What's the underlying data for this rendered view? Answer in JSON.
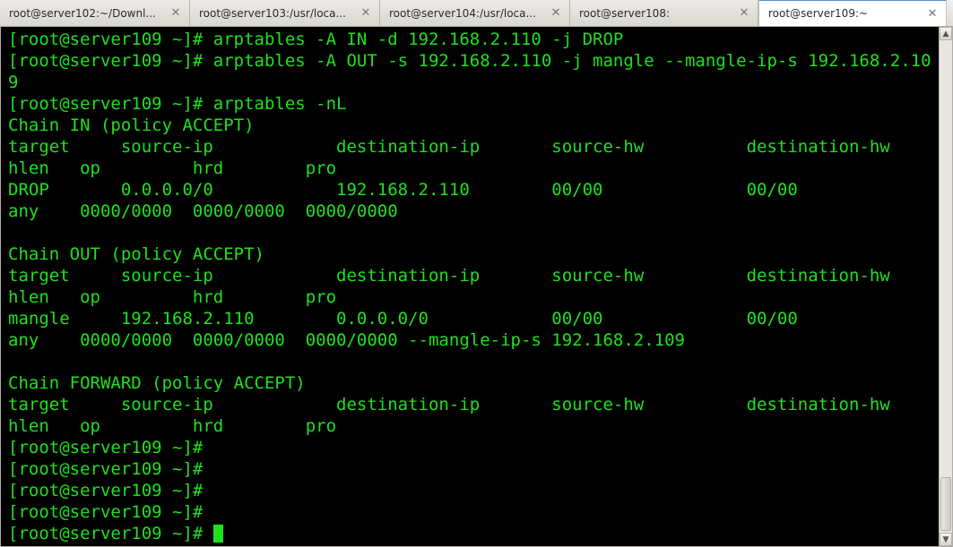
{
  "tabs": [
    {
      "label": "root@server102:~/Downl...",
      "active": false
    },
    {
      "label": "root@server103:/usr/loca...",
      "active": false
    },
    {
      "label": "root@server104:/usr/loca...",
      "active": false
    },
    {
      "label": "root@server108:",
      "active": false
    },
    {
      "label": "root@server109:~",
      "active": true
    }
  ],
  "prompt": "[root@server109 ~]# ",
  "terminal_lines": [
    "[root@server109 ~]# arptables -A IN -d 192.168.2.110 -j DROP",
    "[root@server109 ~]# arptables -A OUT -s 192.168.2.110 -j mangle --mangle-ip-s 192.168.2.109",
    "[root@server109 ~]# arptables -nL",
    "Chain IN (policy ACCEPT)",
    "target     source-ip            destination-ip       source-hw          destination-hw     hlen   op         hrd        pro",
    "DROP       0.0.0.0/0            192.168.2.110        00/00              00/00              any    0000/0000  0000/0000  0000/0000",
    "",
    "Chain OUT (policy ACCEPT)",
    "target     source-ip            destination-ip       source-hw          destination-hw     hlen   op         hrd        pro",
    "mangle     192.168.2.110        0.0.0.0/0            00/00              00/00              any    0000/0000  0000/0000  0000/0000 --mangle-ip-s 192.168.2.109",
    "",
    "Chain FORWARD (policy ACCEPT)",
    "target     source-ip            destination-ip       source-hw          destination-hw     hlen   op         hrd        pro",
    "[root@server109 ~]# ",
    "[root@server109 ~]# ",
    "[root@server109 ~]# ",
    "[root@server109 ~]# "
  ],
  "scrollbar": {
    "up": "▲",
    "down": "▼"
  }
}
